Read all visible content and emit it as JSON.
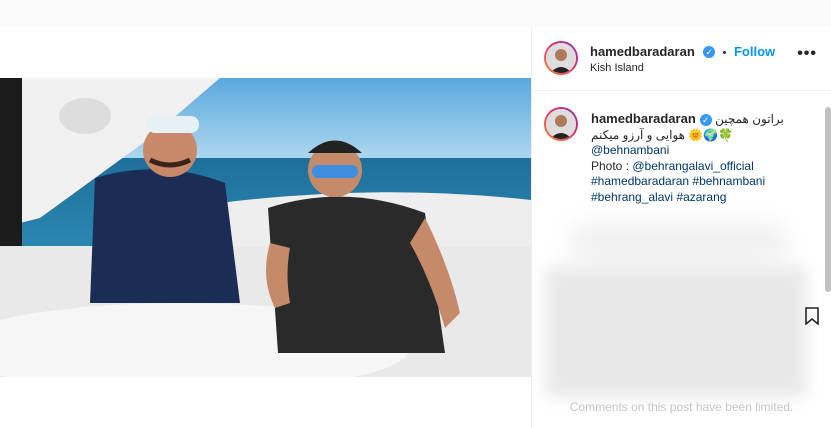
{
  "post": {
    "username": "hamedbaradaran",
    "verified_glyph": "✓",
    "separator": "•",
    "follow_label": "Follow",
    "location": "Kish Island",
    "more_icon": "more-options-icon"
  },
  "caption": {
    "username": "hamedbaradaran",
    "line1": "براتون همچین",
    "line2": "هوایی و آرزو میکنم 🌞🌍🍀",
    "mention1": "@behnambani",
    "photo_prefix": "Photo : ",
    "mention2": "@behrangalavi_official",
    "hashtags1": "#hamedbaradaran #behnambani",
    "hashtags2": "#behrang_alavi #azarang"
  },
  "comments": {
    "limited_text": "Comments on this post have been limited."
  },
  "colors": {
    "link": "#00376b",
    "follow": "#0095f6",
    "verified": "#3897f0"
  }
}
